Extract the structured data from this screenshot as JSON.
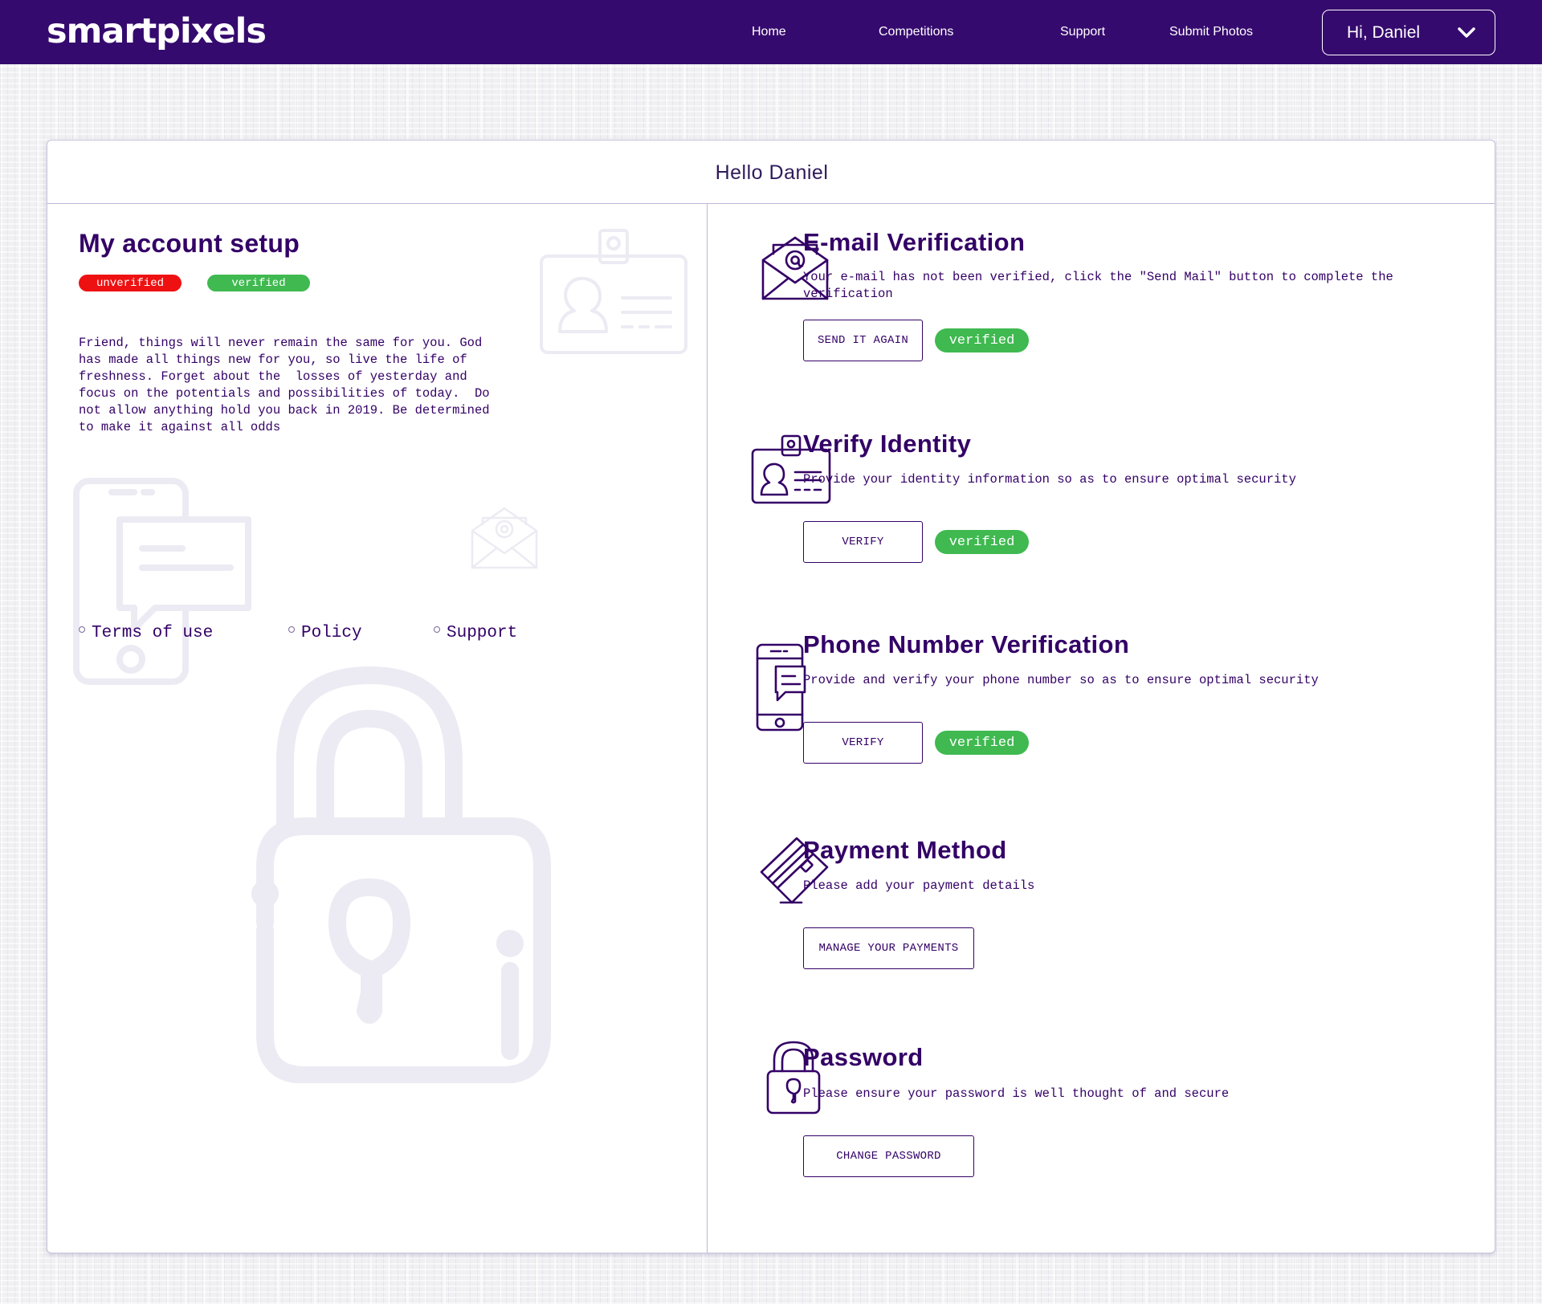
{
  "brand": {
    "logo": "smartpixels"
  },
  "nav": {
    "items": [
      "Home",
      "Competitions",
      "Support",
      "Submit Photos"
    ],
    "user_label": "Hi, Daniel"
  },
  "card": {
    "title": "Hello Daniel"
  },
  "left": {
    "title": "My account setup",
    "legend": {
      "unverified": "unverified",
      "verified": "verified"
    },
    "paragraph": "Friend, things will never remain the same for you. God\nhas made all things new for you, so live the life of\nfreshness. Forget about the  losses of yesterday and\nfocus on the potentials and possibilities of today.  Do\nnot allow anything hold you back in 2019. Be determined\nto make it against all odds",
    "links": [
      "Terms of use",
      "Policy",
      "Support"
    ]
  },
  "sections": [
    {
      "title": "E-mail Verification",
      "description": "Your e-mail has not been verified, click the \"Send Mail\" button to complete the verification",
      "button": "SEND IT AGAIN",
      "status": "verified",
      "icon": "envelope-at-icon"
    },
    {
      "title": "Verify Identity",
      "description": "Provide your identity information so as to ensure optimal security",
      "button": "VERIFY",
      "status": "verified",
      "icon": "id-card-icon"
    },
    {
      "title": "Phone Number Verification",
      "description": "Provide and verify your phone number so as to ensure optimal security",
      "button": "VERIFY",
      "status": "verified",
      "icon": "phone-message-icon"
    },
    {
      "title": "Payment Method",
      "description": "Please add your payment details",
      "button": "MANAGE YOUR PAYMENTS",
      "icon": "credit-card-icon"
    },
    {
      "title": "Password",
      "description": "Please ensure your password is well thought of and secure",
      "button": "CHANGE PASSWORD",
      "icon": "padlock-icon"
    }
  ],
  "colors": {
    "nav_bg": "#350a6e",
    "primary_text": "#330066",
    "verified": "#3fb950",
    "unverified": "#ee1111"
  }
}
